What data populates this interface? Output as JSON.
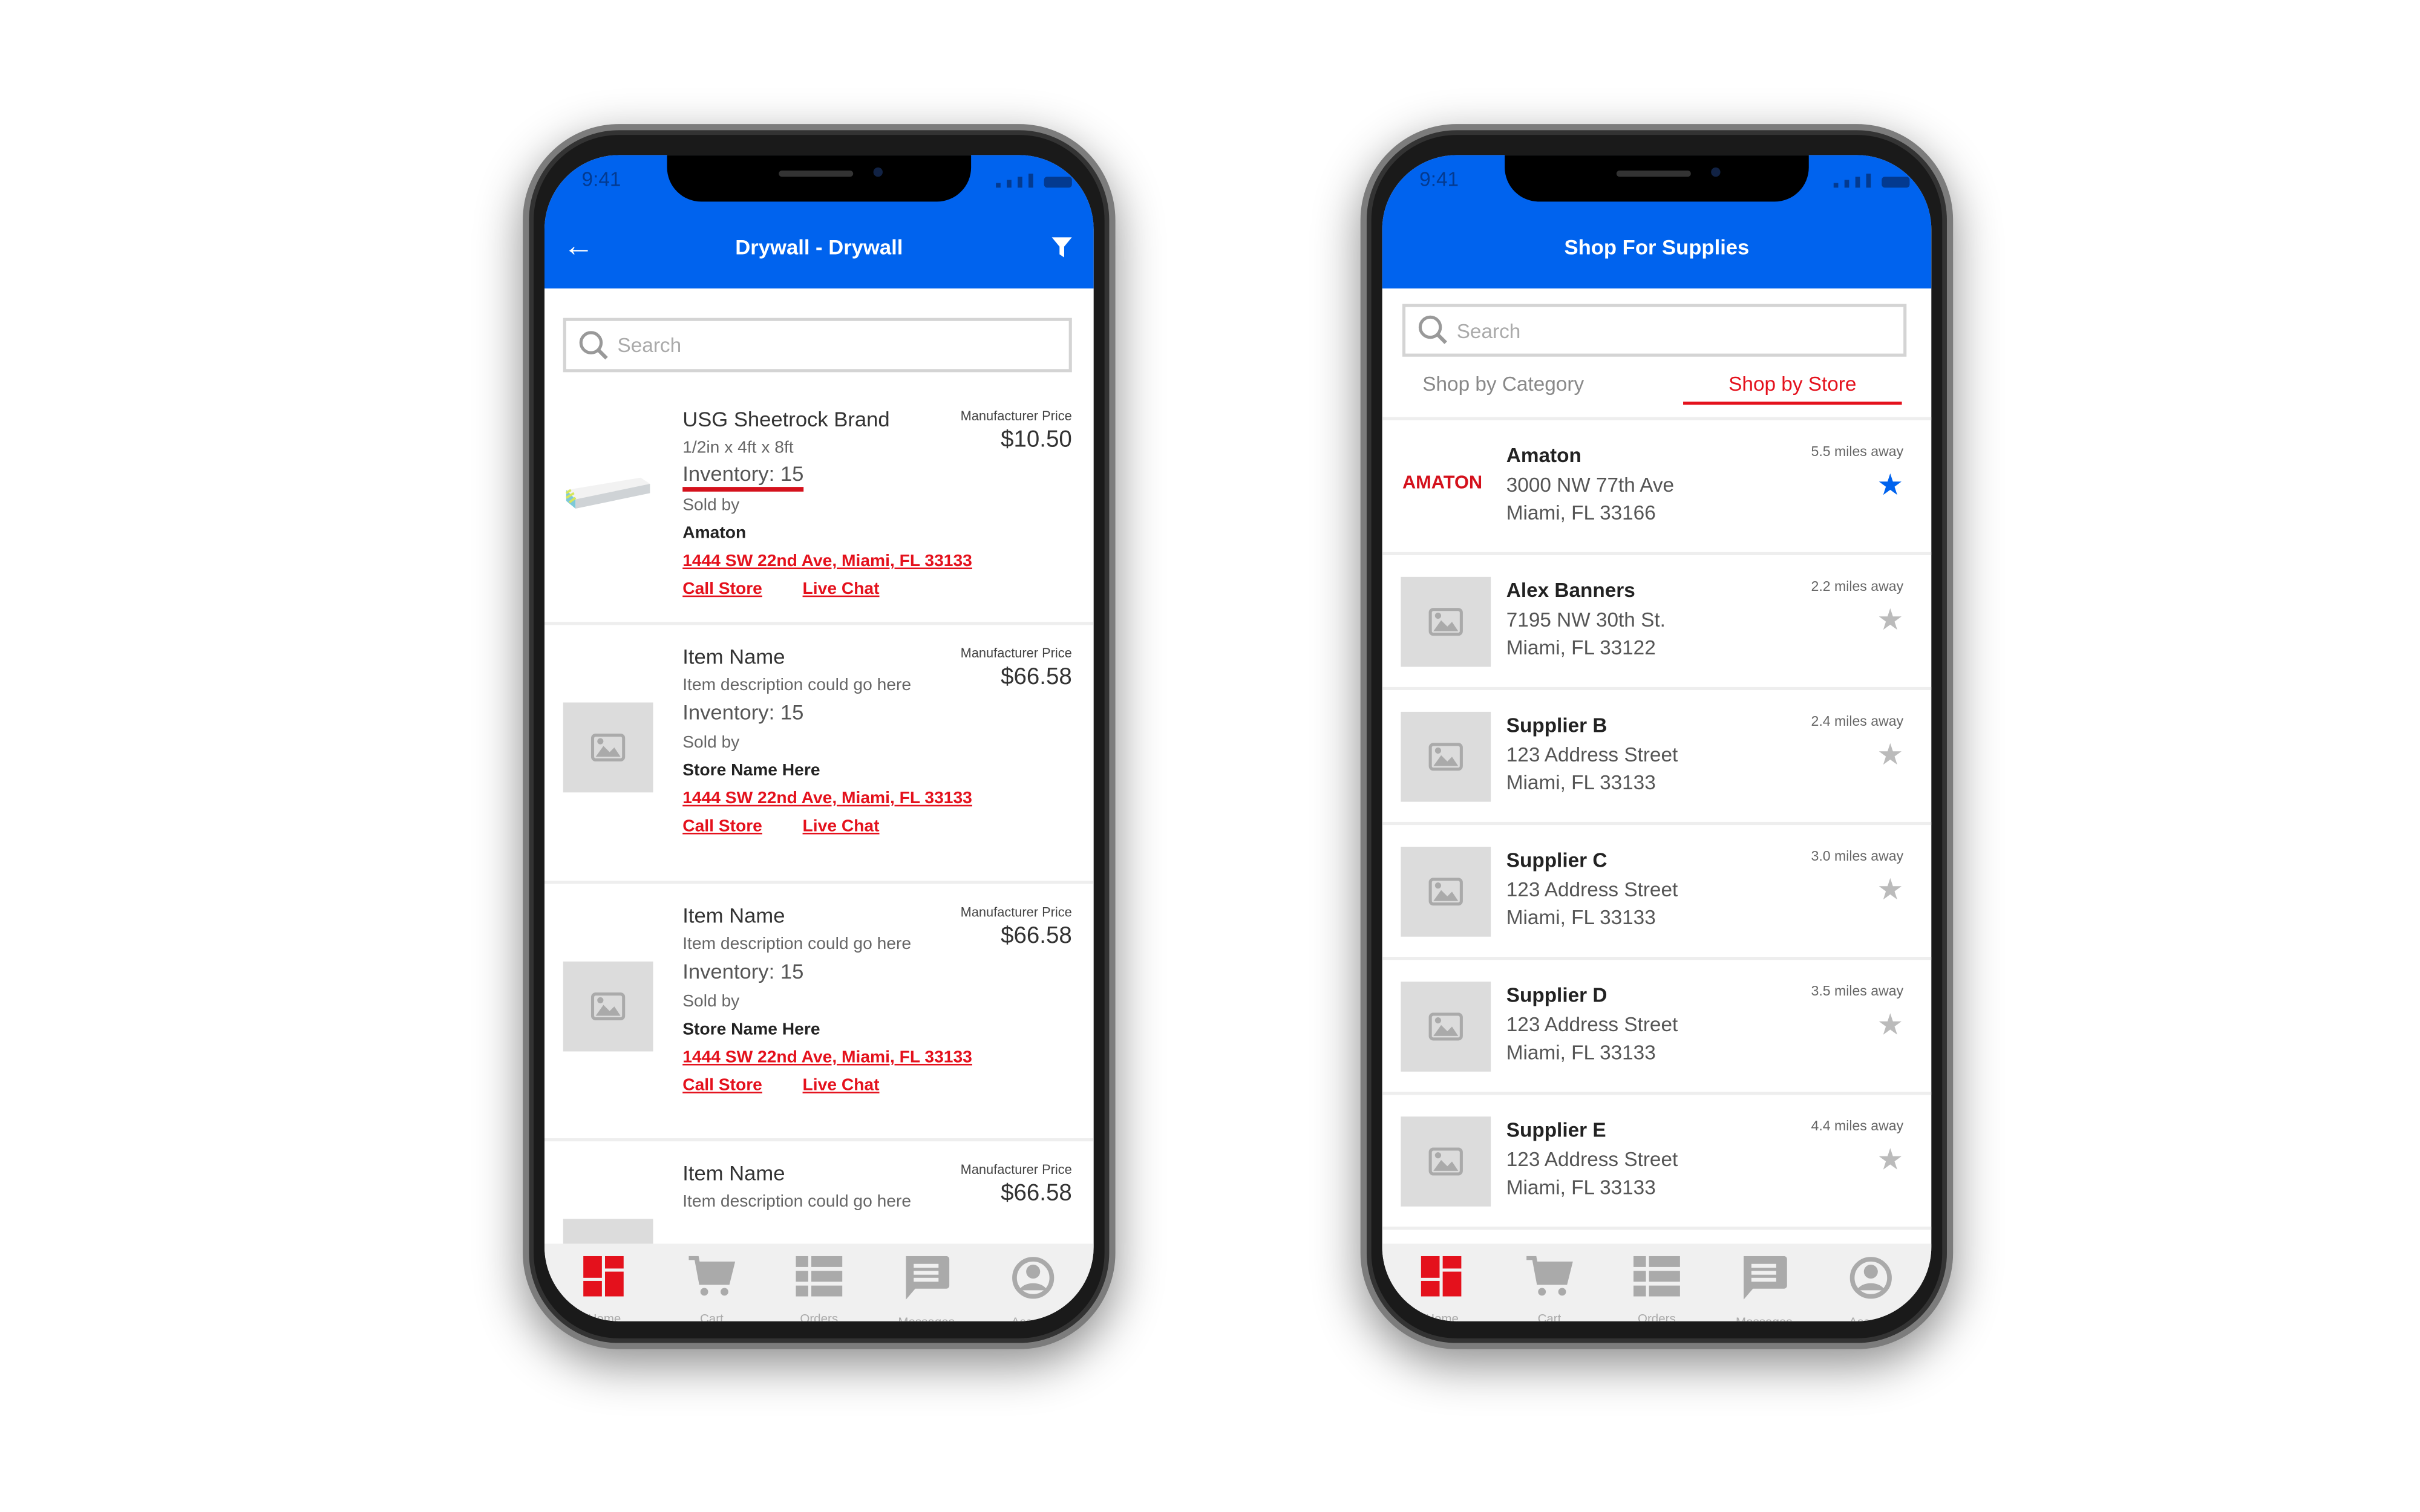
{
  "colors": {
    "brand_blue": "#0063ee",
    "accent_red": "#e4111c",
    "placeholder_gray": "#dcdcdc"
  },
  "left_phone": {
    "status": {
      "time": "9:41"
    },
    "header": {
      "title": "Drywall - Drywall",
      "back_icon": "arrow-left-icon",
      "filter_icon": "filter-icon"
    },
    "search": {
      "placeholder": "Search"
    },
    "items": [
      {
        "name": "USG Sheetrock Brand",
        "description": "1/2in x 4ft x 8ft",
        "inventory": "Inventory: 15",
        "sold_by_label": "Sold by",
        "store": "Amaton",
        "address": "1444 SW 22nd Ave, Miami, FL 33133",
        "call": "Call Store",
        "chat": "Live Chat",
        "price_label": "Manufacturer Price",
        "price": "$10.50",
        "image": "drywall-sheet",
        "highlighted": true
      },
      {
        "name": "Item Name",
        "description": "Item description could go here",
        "inventory": "Inventory: 15",
        "sold_by_label": "Sold by",
        "store": "Store Name Here",
        "address": "1444 SW 22nd Ave, Miami, FL 33133",
        "call": "Call Store",
        "chat": "Live Chat",
        "price_label": "Manufacturer Price",
        "price": "$66.58",
        "image": "placeholder"
      },
      {
        "name": "Item Name",
        "description": "Item description could go here",
        "inventory": "Inventory: 15",
        "sold_by_label": "Sold by",
        "store": "Store Name Here",
        "address": "1444 SW 22nd Ave, Miami, FL 33133",
        "call": "Call Store",
        "chat": "Live Chat",
        "price_label": "Manufacturer Price",
        "price": "$66.58",
        "image": "placeholder"
      },
      {
        "name": "Item Name",
        "description": "Item description could go here",
        "price_label": "Manufacturer Price",
        "price": "$66.58",
        "image": "placeholder"
      }
    ],
    "nav": [
      {
        "label": "Home",
        "icon": "dashboard-icon",
        "active": true
      },
      {
        "label": "Cart",
        "icon": "cart-icon"
      },
      {
        "label": "Orders",
        "icon": "list-icon"
      },
      {
        "label": "Messages",
        "icon": "message-icon"
      },
      {
        "label": "Account",
        "icon": "account-icon"
      }
    ]
  },
  "right_phone": {
    "status": {
      "time": "9:41"
    },
    "header": {
      "title": "Shop For Supplies"
    },
    "search": {
      "placeholder": "Search"
    },
    "tabs": [
      {
        "label": "Shop by Category",
        "active": false
      },
      {
        "label": "Shop by Store",
        "active": true
      }
    ],
    "stores": [
      {
        "name": "Amaton",
        "address1": "3000 NW 77th Ave",
        "address2": "Miami, FL 33166",
        "distance": "5.5 miles away",
        "favorite": true,
        "logo": "AMATON"
      },
      {
        "name": "Alex Banners",
        "address1": "7195 NW 30th St.",
        "address2": "Miami, FL 33122",
        "distance": "2.2 miles away",
        "favorite": false
      },
      {
        "name": "Supplier B",
        "address1": "123 Address Street",
        "address2": "Miami, FL 33133",
        "distance": "2.4 miles away",
        "favorite": false
      },
      {
        "name": "Supplier C",
        "address1": "123 Address Street",
        "address2": "Miami, FL 33133",
        "distance": "3.0 miles away",
        "favorite": false
      },
      {
        "name": "Supplier D",
        "address1": "123 Address Street",
        "address2": "Miami, FL 33133",
        "distance": "3.5 miles away",
        "favorite": false
      },
      {
        "name": "Supplier E",
        "address1": "123 Address Street",
        "address2": "Miami, FL 33133",
        "distance": "4.4 miles away",
        "favorite": false
      }
    ],
    "nav": [
      {
        "label": "Home",
        "icon": "dashboard-icon",
        "active": true
      },
      {
        "label": "Cart",
        "icon": "cart-icon"
      },
      {
        "label": "Orders",
        "icon": "list-icon"
      },
      {
        "label": "Messages",
        "icon": "message-icon"
      },
      {
        "label": "Account",
        "icon": "account-icon"
      }
    ]
  }
}
